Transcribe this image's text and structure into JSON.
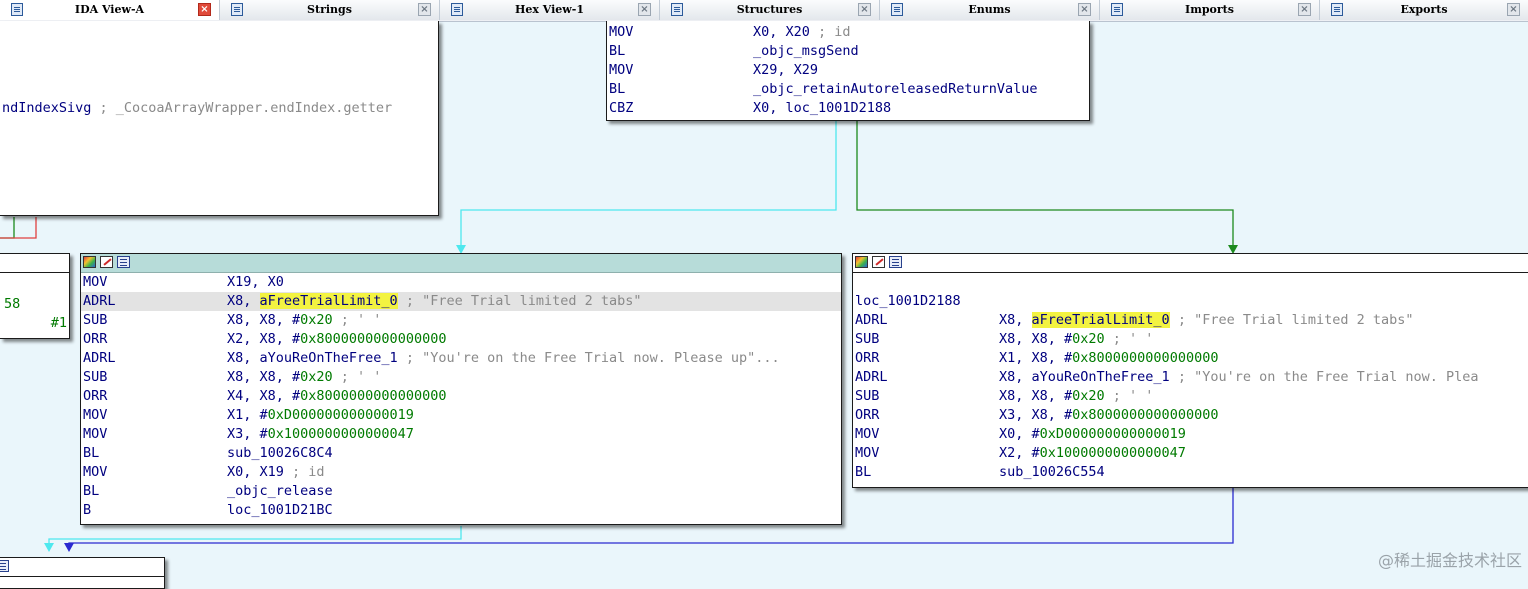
{
  "tabs": [
    {
      "label": "IDA View-A",
      "icon": "ida-view-icon",
      "active": true
    },
    {
      "label": "Strings",
      "icon": "strings-icon",
      "active": false
    },
    {
      "label": "Hex View-1",
      "icon": "hex-view-icon",
      "active": false
    },
    {
      "label": "Structures",
      "icon": "structures-icon",
      "active": false
    },
    {
      "label": "Enums",
      "icon": "enums-icon",
      "active": false
    },
    {
      "label": "Imports",
      "icon": "imports-icon",
      "active": false
    },
    {
      "label": "Exports",
      "icon": "exports-icon",
      "active": false
    }
  ],
  "close_glyph": "×",
  "top_left_node": {
    "text1": "ndIndexSivg",
    "comment": " ; _CocoaArrayWrapper.endIndex.getter"
  },
  "top_center_node": {
    "lines": [
      {
        "m": "MOV",
        "o": "X0, X20",
        "c": " ; id"
      },
      {
        "m": "BL",
        "o": "_objc_msgSend",
        "c": ""
      },
      {
        "m": "MOV",
        "o": "X29, X29",
        "c": ""
      },
      {
        "m": "BL",
        "o": "_objc_retainAutoreleasedReturnValue",
        "c": ""
      },
      {
        "m": "CBZ",
        "o": "X0, loc_1001D2188",
        "c": ""
      }
    ]
  },
  "mid_left_fragment": {
    "t1": "58",
    "t2": "#1"
  },
  "main_node": {
    "l1_m": "MOV",
    "l1_o": "X19, X0",
    "l2_m": "ADRL",
    "l2_o": "X8, ",
    "l2_h": "aFreeTrialLimit_0",
    "l2_c": " ; \"Free Trial limited 2 tabs\"",
    "l3_m": "SUB",
    "l3_o": "X8, X8, #",
    "l3_n": "0x20",
    "l3_c": " ; ' '",
    "l4_m": "ORR",
    "l4_o": "X2, X8, #",
    "l4_n": "0x8000000000000000",
    "l5_m": "ADRL",
    "l5_o": "X8, aYouReOnTheFree_1",
    "l5_c": " ; \"You're on the Free Trial now. Please up\"...",
    "l6_m": "SUB",
    "l6_o": "X8, X8, #",
    "l6_n": "0x20",
    "l6_c": " ; ' '",
    "l7_m": "ORR",
    "l7_o": "X4, X8, #",
    "l7_n": "0x8000000000000000",
    "l8_m": "MOV",
    "l8_o": "X1, #",
    "l8_n": "0xD000000000000019",
    "l9_m": "MOV",
    "l9_o": "X3, #",
    "l9_n": "0x1000000000000047",
    "l10_m": "BL",
    "l10_o": "sub_10026C8C4",
    "l11_m": "MOV",
    "l11_o": "X0, X19",
    "l11_c": " ; id",
    "l12_m": "BL",
    "l12_o": "_objc_release",
    "l13_m": "B",
    "l13_o": "loc_1001D21BC"
  },
  "right_node": {
    "label": "loc_1001D2188",
    "l1_m": "ADRL",
    "l1_o": "X8, ",
    "l1_h": "aFreeTrialLimit_0",
    "l1_c": " ; \"Free Trial limited 2 tabs\"",
    "l2_m": "SUB",
    "l2_o": "X8, X8, #",
    "l2_n": "0x20",
    "l2_c": " ; ' '",
    "l3_m": "ORR",
    "l3_o": "X1, X8, #",
    "l3_n": "0x8000000000000000",
    "l4_m": "ADRL",
    "l4_o": "X8, aYouReOnTheFree_1",
    "l4_c": " ; \"You're on the Free Trial now. Plea",
    "l5_m": "SUB",
    "l5_o": "X8, X8, #",
    "l5_n": "0x20",
    "l5_c": " ; ' '",
    "l6_m": "ORR",
    "l6_o": "X3, X8, #",
    "l6_n": "0x8000000000000000",
    "l7_m": "MOV",
    "l7_o": "X0, #",
    "l7_n": "0xD000000000000019",
    "l8_m": "MOV",
    "l8_o": "X2, #",
    "l8_n": "0x1000000000000047",
    "l9_m": "BL",
    "l9_o": "sub_10026C554"
  },
  "edge_colors": {
    "cyan": "#4ee8ee",
    "green": "#1d8a1d",
    "blue": "#2a2ad0",
    "red": "#e04040"
  },
  "watermark": "@稀土掘金技术社区"
}
